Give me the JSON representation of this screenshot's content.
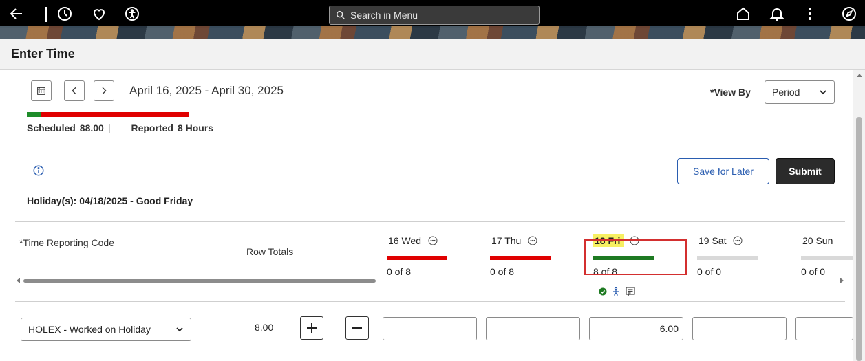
{
  "topbar": {
    "search_placeholder": "Search in Menu",
    "icons": [
      "back-arrow-icon",
      "history-icon",
      "favorites-heart-icon",
      "accessibility-icon",
      "home-icon",
      "bell-icon",
      "more-vertical-icon",
      "navigator-compass-icon"
    ]
  },
  "page": {
    "title": "Enter Time"
  },
  "period": {
    "date_range": "April 16, 2025 - April 30, 2025",
    "progress_fraction": 0.09,
    "scheduled_label": "Scheduled",
    "scheduled_value": "88.00",
    "reported_label": "Reported",
    "reported_value": "8 Hours"
  },
  "view_by": {
    "label": "*View By",
    "selected": "Period"
  },
  "actions": {
    "save_label": "Save for Later",
    "submit_label": "Submit"
  },
  "holiday_text": "Holiday(s): 04/18/2025 - Good Friday",
  "grid": {
    "trc_header": "*Time Reporting Code",
    "row_totals_header": "Row Totals",
    "days": [
      {
        "label": "16 Wed",
        "count": "0 of 8",
        "bar_color": "#e00000",
        "today": false
      },
      {
        "label": "17 Thu",
        "count": "0 of 8",
        "bar_color": "#e00000",
        "today": false
      },
      {
        "label": "18 Fri",
        "count": "8 of 8",
        "bar_color": "#1e7a22",
        "today": true
      },
      {
        "label": "19 Sat",
        "count": "0 of 0",
        "bar_color": "#d9d9d9",
        "today": false
      },
      {
        "label": "20 Sun",
        "count": "0 of 0",
        "bar_color": "#d9d9d9",
        "today": false
      }
    ],
    "row": {
      "trc_value": "HOLEX - Worked on Holiday",
      "row_total": "8.00",
      "hours": [
        "",
        "",
        "6.00",
        "",
        ""
      ]
    }
  },
  "colors": {
    "accent_blue": "#2a5db0",
    "highlight_red": "#d32f2f",
    "today_highlight": "#f7f062"
  }
}
